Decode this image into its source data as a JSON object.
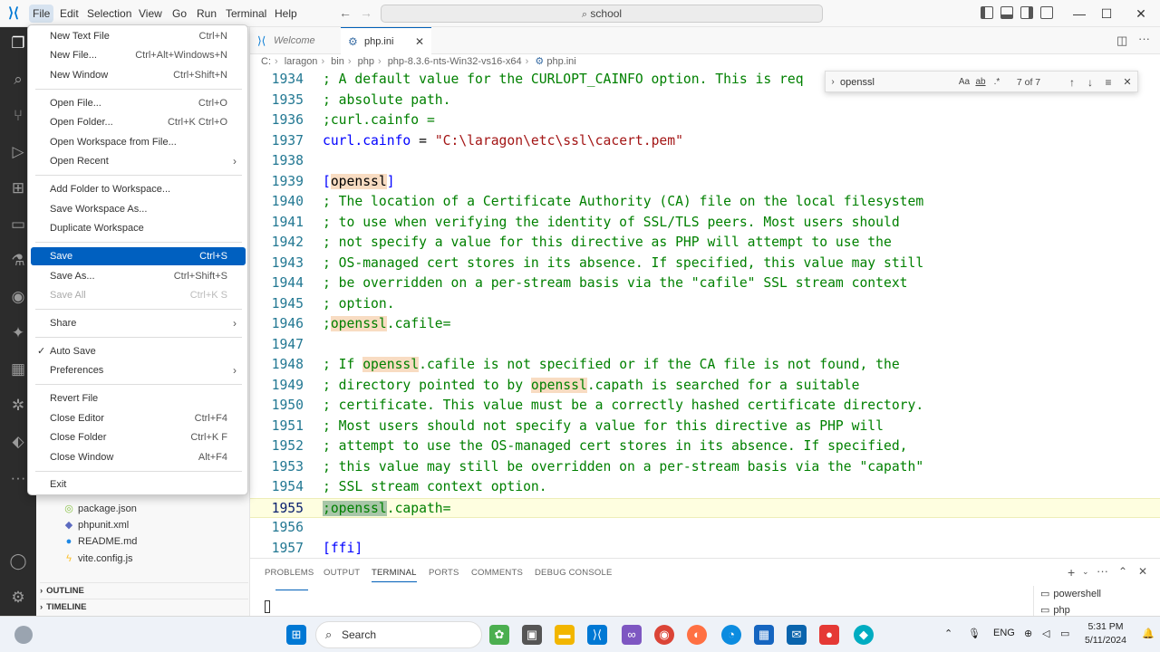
{
  "titlebar": {
    "menus": [
      "File",
      "Edit",
      "Selection",
      "View",
      "Go",
      "Run",
      "Terminal",
      "Help"
    ],
    "search_text": "school"
  },
  "tabs": [
    {
      "label": "Welcome",
      "icon": "vscode-icon"
    },
    {
      "label": "php.ini",
      "icon": "gear-icon",
      "close": "✕"
    }
  ],
  "breadcrumbs": [
    "C:",
    "laragon",
    "bin",
    "php",
    "php-8.3.6-nts-Win32-vs16-x64",
    "php.ini"
  ],
  "find": {
    "value": "openssl",
    "opt_case": "Aa",
    "opt_word": "ab",
    "opt_regex": ".*",
    "count": "7 of 7"
  },
  "editor": {
    "lines": [
      {
        "n": "1934",
        "t": "; A default value for the CURLOPT_CAINFO option. This is req"
      },
      {
        "n": "1935",
        "t": "; absolute path."
      },
      {
        "n": "1936",
        "t": ";curl.cainfo ="
      },
      {
        "n": "1937",
        "a": "curl.cainfo",
        "b": " = ",
        "c": "\"C:\\laragon\\etc\\ssl\\cacert.pem\""
      },
      {
        "n": "1938",
        "t": ""
      },
      {
        "n": "1939",
        "a": "[",
        "h": "openssl",
        "c": "]"
      },
      {
        "n": "1940",
        "t": "; The location of a Certificate Authority (CA) file on the local filesystem"
      },
      {
        "n": "1941",
        "t": "; to use when verifying the identity of SSL/TLS peers. Most users should"
      },
      {
        "n": "1942",
        "t": "; not specify a value for this directive as PHP will attempt to use the"
      },
      {
        "n": "1943",
        "t": "; OS-managed cert stores in its absence. If specified, this value may still"
      },
      {
        "n": "1944",
        "t": "; be overridden on a per-stream basis via the \"cafile\" SSL stream context"
      },
      {
        "n": "1945",
        "t": "; option."
      },
      {
        "n": "1946",
        "a": ";",
        "h": "openssl",
        "c": ".cafile="
      },
      {
        "n": "1947",
        "t": ""
      },
      {
        "n": "1948",
        "a": "; If ",
        "h": "openssl",
        "c": ".cafile is not specified or if the CA file is not found, the"
      },
      {
        "n": "1949",
        "a": "; directory pointed to by ",
        "h": "openssl",
        "c": ".capath is searched for a suitable"
      },
      {
        "n": "1950",
        "t": "; certificate. This value must be a correctly hashed certificate directory."
      },
      {
        "n": "1951",
        "t": "; Most users should not specify a value for this directive as PHP will"
      },
      {
        "n": "1952",
        "t": "; attempt to use the OS-managed cert stores in its absence. If specified,"
      },
      {
        "n": "1953",
        "t": "; this value may still be overridden on a per-stream basis via the \"capath\""
      },
      {
        "n": "1954",
        "t": "; SSL stream context option."
      },
      {
        "n": "1955",
        "a": ";",
        "h": "openssl",
        "c": ".capath="
      },
      {
        "n": "1956",
        "t": ""
      },
      {
        "n": "1957",
        "t": "[ffi]"
      }
    ]
  },
  "file_menu": {
    "items": [
      {
        "label": "New Text File",
        "shortcut": "Ctrl+N"
      },
      {
        "label": "New File...",
        "shortcut": "Ctrl+Alt+Windows+N"
      },
      {
        "label": "New Window",
        "shortcut": "Ctrl+Shift+N"
      },
      {
        "label": "Open File...",
        "shortcut": "Ctrl+O"
      },
      {
        "label": "Open Folder...",
        "shortcut": "Ctrl+K Ctrl+O"
      },
      {
        "label": "Open Workspace from File...",
        "shortcut": ""
      },
      {
        "label": "Open Recent",
        "shortcut": ""
      },
      {
        "label": "Add Folder to Workspace...",
        "shortcut": ""
      },
      {
        "label": "Save Workspace As...",
        "shortcut": ""
      },
      {
        "label": "Duplicate Workspace",
        "shortcut": ""
      },
      {
        "label": "Save",
        "shortcut": "Ctrl+S"
      },
      {
        "label": "Save As...",
        "shortcut": "Ctrl+Shift+S"
      },
      {
        "label": "Save All",
        "shortcut": "Ctrl+K S"
      },
      {
        "label": "Share",
        "shortcut": ""
      },
      {
        "label": "Auto Save",
        "shortcut": ""
      },
      {
        "label": "Preferences",
        "shortcut": ""
      },
      {
        "label": "Revert File",
        "shortcut": ""
      },
      {
        "label": "Close Editor",
        "shortcut": "Ctrl+F4"
      },
      {
        "label": "Close Folder",
        "shortcut": "Ctrl+K F"
      },
      {
        "label": "Close Window",
        "shortcut": "Alt+F4"
      },
      {
        "label": "Exit",
        "shortcut": ""
      }
    ]
  },
  "explorer": {
    "files": [
      {
        "label": "package.json",
        "icon": "json-icon",
        "color": "#8bc34a"
      },
      {
        "label": "phpunit.xml",
        "icon": "xml-icon",
        "color": "#5c6bc0"
      },
      {
        "label": "README.md",
        "icon": "info-icon",
        "color": "#1e88e5"
      },
      {
        "label": "vite.config.js",
        "icon": "bolt-icon",
        "color": "#fbc02d"
      }
    ],
    "sections": [
      "OUTLINE",
      "TIMELINE"
    ]
  },
  "panel": {
    "tabs": [
      "PROBLEMS",
      "OUTPUT",
      "TERMINAL",
      "PORTS",
      "COMMENTS",
      "DEBUG CONSOLE"
    ],
    "active_tab": "TERMINAL",
    "terminals": [
      "powershell",
      "php"
    ]
  },
  "taskbar": {
    "search_placeholder": "Search",
    "language": "ENG",
    "time": "5:31 PM",
    "date": "5/11/2024"
  },
  "colors": {
    "accent": "#005fb8",
    "find_highlight": "#f8dcc2",
    "current_line": "#fefee0",
    "comment": "#008000",
    "string": "#a31515",
    "menu_selected": "#0060c0"
  }
}
